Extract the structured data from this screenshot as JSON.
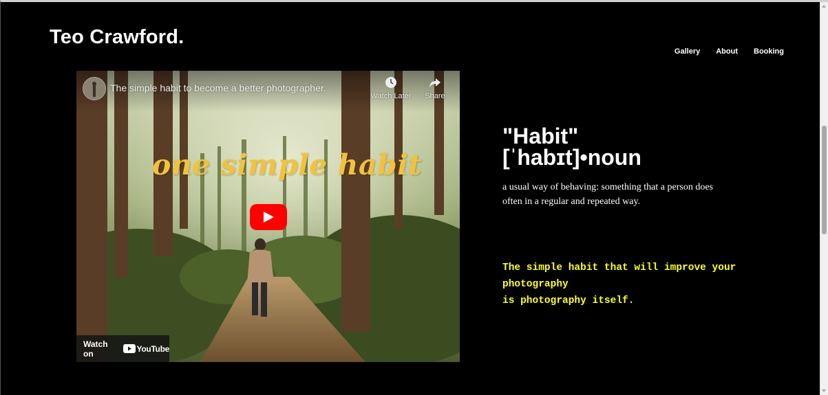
{
  "header": {
    "brand": "Teo Crawford.",
    "nav": [
      "Gallery",
      "About",
      "Booking"
    ]
  },
  "video": {
    "title": "The simple habit to become a better photographer.",
    "watch_later_label": "Watch Later",
    "share_label": "Share",
    "thumbnail_text": "one simple habit",
    "watch_on_label": "Watch on",
    "youtube_word": "YouTube",
    "icons": [
      "clock-icon",
      "share-arrow-icon",
      "play-icon",
      "youtube-logo-icon"
    ],
    "play_color": "#ff0000"
  },
  "definition": {
    "word": "\"Habit\"",
    "pronunciation": "[ˈhabɪt]•noun",
    "meaning": "a usual way of behaving: something that a person does often in a regular and repeated way."
  },
  "quote": {
    "line1": "The simple habit that will improve your photography",
    "line2": "is photography itself."
  },
  "colors": {
    "background": "#000000",
    "quote": "#ffff22",
    "thumbnail_text": "#f2c23c"
  }
}
